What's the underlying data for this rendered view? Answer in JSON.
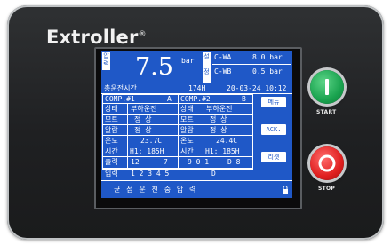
{
  "brand": {
    "name": "Extroller",
    "mark": "®"
  },
  "display": {
    "side_left_top": "압",
    "side_left_bottom": "력",
    "pressure_value": "7.5",
    "pressure_unit": "bar",
    "side_right_top": "설",
    "side_right_bottom": "정",
    "setpoints": [
      {
        "label": "C-WA",
        "value": "8.0 bar"
      },
      {
        "label": "C-WB",
        "value": "0.5 bar"
      }
    ],
    "total_time_label": "총운전시간",
    "total_time_value": "174H",
    "date_time": "20-03-24 10:12",
    "comp1": {
      "label": "COMP.#1",
      "unit": "A"
    },
    "comp2": {
      "label": "COMP.#2",
      "unit": "B"
    },
    "rows": [
      {
        "l1": "상태",
        "v1": "부하운전",
        "l2": "상태",
        "v2": "부하운전"
      },
      {
        "l1": "모트",
        "v1": "정  상",
        "l2": "모트",
        "v2": "정  상"
      },
      {
        "l1": "알람",
        "v1": "정  상",
        "l2": "알람",
        "v2": "정  상"
      },
      {
        "l1": "온도",
        "v1": "23.7C",
        "l2": "온도",
        "v2": "24.4C"
      },
      {
        "l1": "시간",
        "v1": "H1:   185H",
        "l2": "시간",
        "v2": "H1:   185H"
      }
    ],
    "output_label": "출력",
    "output_values": [
      "12",
      "7",
      "9 0 1",
      "D 8"
    ],
    "input_label": "입력",
    "input_values": "1 2 3 4 5",
    "input_extra": "D",
    "status_line": "균 점 운 전 중 압 력",
    "soft_buttons": [
      "메뉴",
      "ACK.",
      "리셋"
    ]
  },
  "controls": {
    "start_label": "START",
    "stop_label": "STOP"
  }
}
